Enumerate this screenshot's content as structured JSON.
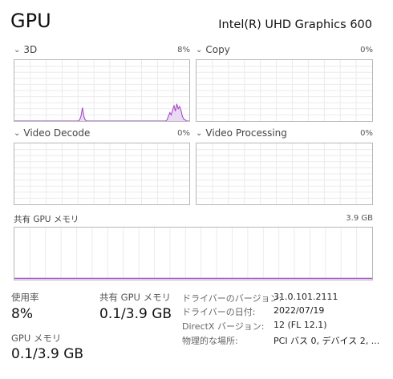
{
  "header": {
    "title": "GPU",
    "model": "Intel(R) UHD Graphics 600"
  },
  "engines": [
    {
      "label": "3D",
      "percent": "8%",
      "usage_series": [
        0,
        0,
        0,
        0,
        0,
        0,
        0,
        0,
        0,
        0,
        0,
        0,
        0,
        0,
        0,
        0,
        0,
        0,
        0,
        0,
        0,
        0,
        0,
        0,
        0,
        0,
        0,
        0,
        0,
        0,
        0,
        0,
        0,
        0,
        0,
        0,
        0,
        0,
        0,
        0,
        0,
        0,
        0,
        0,
        0,
        0,
        0,
        2,
        8,
        22,
        8,
        2,
        0,
        0,
        0,
        0,
        0,
        0,
        0,
        0,
        0,
        0,
        0,
        0,
        0,
        0,
        0,
        0,
        0,
        0,
        0,
        0,
        0,
        0,
        0,
        0,
        0,
        0,
        0,
        0,
        0,
        0,
        0,
        0,
        0,
        0,
        0,
        0,
        0,
        0,
        0,
        0,
        0,
        0,
        0,
        0,
        0,
        0,
        0,
        0,
        0,
        0,
        0,
        0,
        0,
        0,
        0,
        0,
        0,
        0,
        2,
        8,
        14,
        10,
        18,
        25,
        16,
        28,
        20,
        24,
        18,
        8,
        3,
        2,
        0,
        0,
        0
      ]
    },
    {
      "label": "Copy",
      "percent": "0%"
    },
    {
      "label": "Video Decode",
      "percent": "0%"
    },
    {
      "label": "Video Processing",
      "percent": "0%"
    }
  ],
  "shared_memory": {
    "label": "共有 GPU メモリ",
    "total": "3.9 GB",
    "usage_fraction": 0.026
  },
  "stats": {
    "usage_label": "使用率",
    "usage_value": "8%",
    "shared_label": "共有 GPU メモリ",
    "shared_value": "0.1/3.9 GB",
    "gpu_mem_label": "GPU メモリ",
    "gpu_mem_value": "0.1/3.9 GB"
  },
  "info": [
    {
      "key": "ドライバーのバージョン:",
      "value": "31.0.101.2111"
    },
    {
      "key": "ドライバーの日付:",
      "value": "2022/07/19"
    },
    {
      "key": "DirectX バージョン:",
      "value": "12 (FL 12.1)"
    },
    {
      "key": "物理的な場所:",
      "value": "PCI バス 0, デバイス 2, ..."
    }
  ],
  "colors": {
    "accent": "#a040c0",
    "fill": "#e9daf3",
    "grid": "#ebebeb",
    "border": "#b7b7b7"
  }
}
